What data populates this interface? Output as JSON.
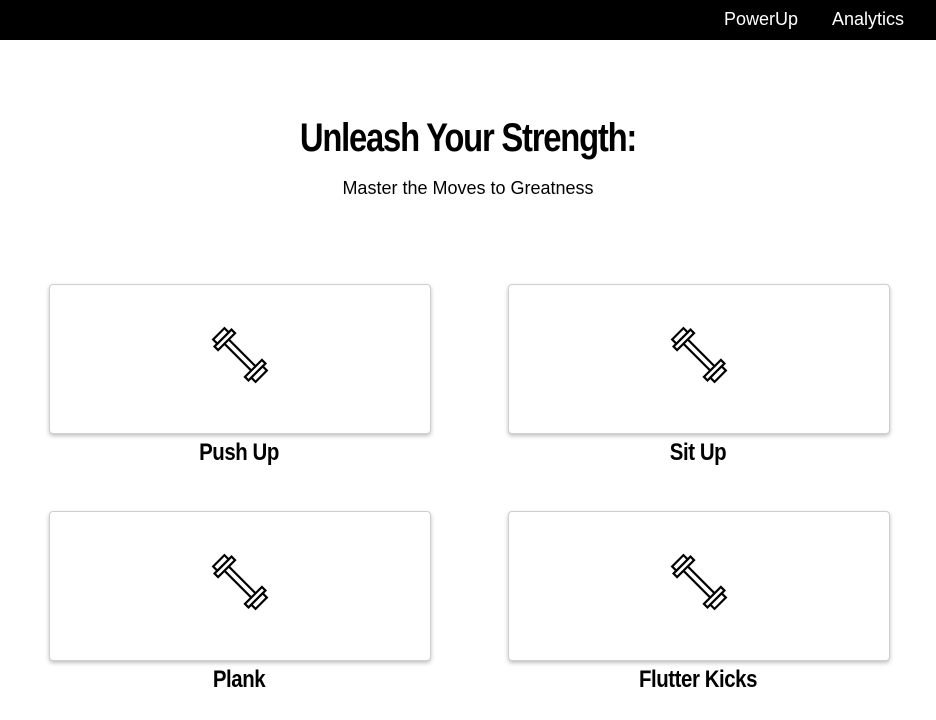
{
  "nav": {
    "items": [
      {
        "label": "PowerUp"
      },
      {
        "label": "Analytics"
      }
    ]
  },
  "hero": {
    "title": "Unleash Your Strength:",
    "subtitle": "Master the Moves to Greatness"
  },
  "exercises": [
    {
      "label": "Push Up",
      "icon": "dumbbell-icon"
    },
    {
      "label": "Sit Up",
      "icon": "dumbbell-icon"
    },
    {
      "label": "Plank",
      "icon": "dumbbell-icon"
    },
    {
      "label": "Flutter Kicks",
      "icon": "dumbbell-icon"
    }
  ],
  "colors": {
    "topbar": "#000000",
    "background": "#ffffff",
    "text": "#000000",
    "card_border": "#cfcfcf"
  }
}
